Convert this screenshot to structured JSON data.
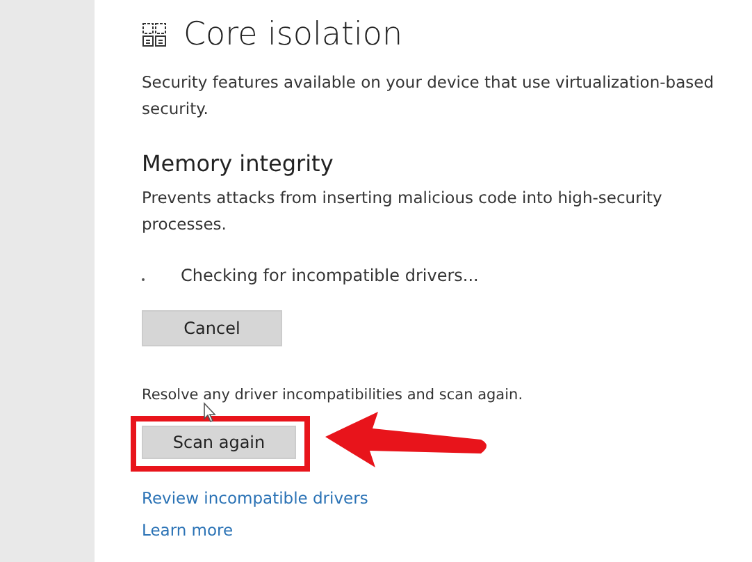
{
  "page": {
    "title": "Core isolation",
    "description": "Security features available on your device that use virtualization-based security."
  },
  "memory_integrity": {
    "heading": "Memory integrity",
    "description": "Prevents attacks from inserting malicious code into high-security processes.",
    "status": "Checking for incompatible drivers...",
    "cancel_button": "Cancel",
    "resolve_text": "Resolve any driver incompatibilities and scan again.",
    "scan_button": "Scan again",
    "links": [
      "Review incompatible drivers",
      "Learn more"
    ]
  },
  "annotation": {
    "highlight_box": true,
    "arrow": true
  }
}
